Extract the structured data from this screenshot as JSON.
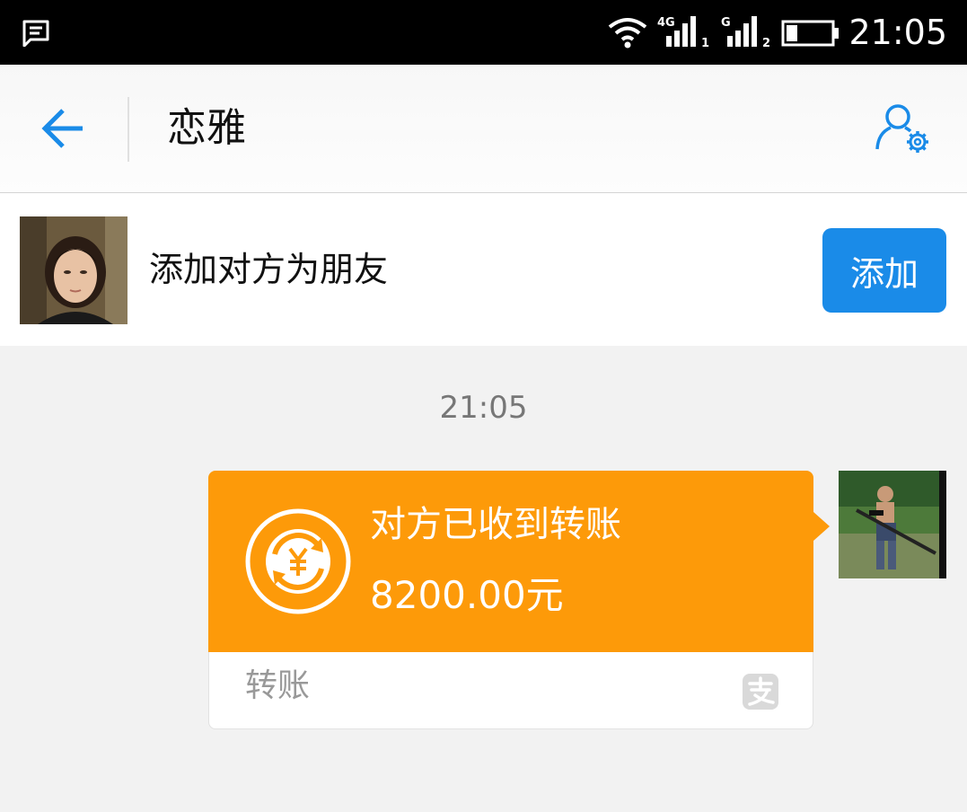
{
  "status_bar": {
    "time": "21:05",
    "network_1": "4G",
    "sim_1": "1",
    "network_2": "G",
    "sim_2": "2",
    "battery_level": 0.25,
    "icons": [
      "message-icon",
      "wifi-icon",
      "signal-icon",
      "signal-icon",
      "battery-icon"
    ]
  },
  "header": {
    "title": "恋雅",
    "back_icon": "arrow-left-icon",
    "settings_icon": "user-settings-icon"
  },
  "friend_bar": {
    "prompt": "添加对方为朋友",
    "add_label": "添加"
  },
  "chat": {
    "timestamp": "21:05",
    "transfer": {
      "status": "对方已收到转账",
      "amount": "8200.00元",
      "kind": "转账",
      "icon": "yuan-refresh-icon",
      "brand_icon": "alipay-icon"
    }
  },
  "colors": {
    "accent": "#1a8be8",
    "transfer_orange": "#fd9a09",
    "background": "#f2f2f2"
  }
}
